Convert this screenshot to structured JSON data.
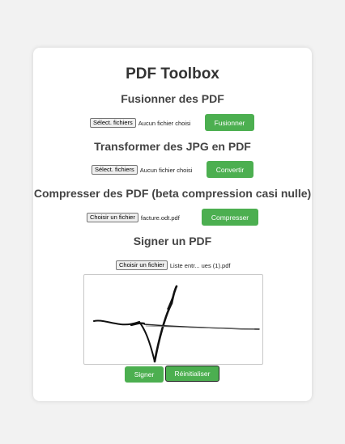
{
  "app": {
    "title": "PDF Toolbox"
  },
  "sections": {
    "merge": {
      "title": "Fusionner des PDF",
      "file_button": "Sélect. fichiers",
      "file_status": "Aucun fichier choisi",
      "action_label": "Fusionner"
    },
    "convert": {
      "title": "Transformer des JPG en PDF",
      "file_button": "Sélect. fichiers",
      "file_status": "Aucun fichier choisi",
      "action_label": "Convertir"
    },
    "compress": {
      "title": "Compresser des PDF (beta compression casi nulle)",
      "file_button": "Choisir un fichier",
      "file_status": "facture.odt.pdf",
      "action_label": "Compresser"
    },
    "sign": {
      "title": "Signer un PDF",
      "file_button": "Choisir un fichier",
      "file_status": "Liste entr... ues (1).pdf",
      "sign_label": "Signer",
      "reset_label": "Réinitialiser"
    }
  },
  "colors": {
    "accent": "#4caf50",
    "background": "#f2f2f2",
    "card": "#ffffff"
  }
}
